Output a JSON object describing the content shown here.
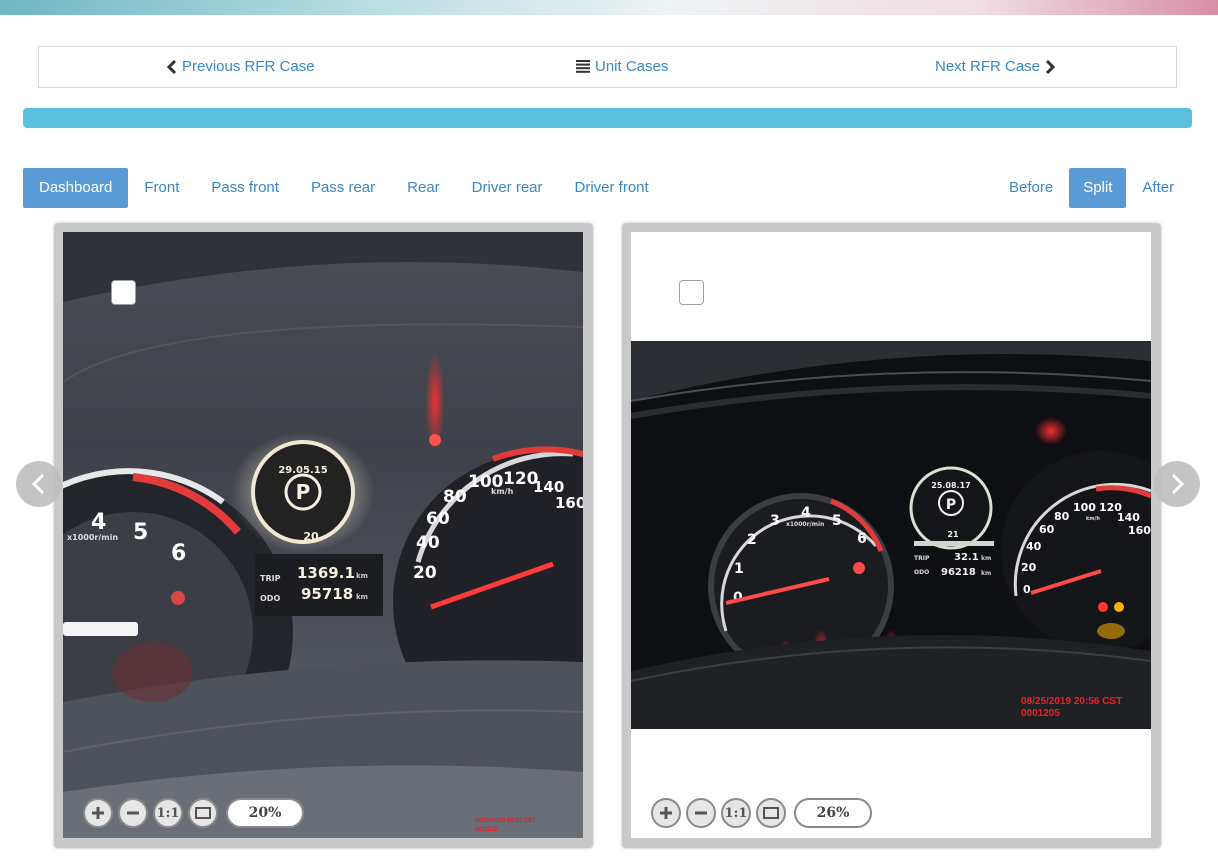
{
  "nav": {
    "previous": "Previous RFR Case",
    "unit_cases": "Unit Cases",
    "next": "Next RFR Case"
  },
  "colors": {
    "link": "#3b86c4",
    "active_tab": "#5b9bd5",
    "progress": "#5bc0de",
    "stamp": "#e8202a"
  },
  "progress": {
    "fraction": 1.0
  },
  "tabs": [
    {
      "label": "Dashboard",
      "active": true
    },
    {
      "label": "Front",
      "active": false
    },
    {
      "label": "Pass front",
      "active": false
    },
    {
      "label": "Pass rear",
      "active": false
    },
    {
      "label": "Rear",
      "active": false
    },
    {
      "label": "Driver rear",
      "active": false
    },
    {
      "label": "Driver front",
      "active": false
    }
  ],
  "view_modes": [
    {
      "label": "Before",
      "active": false
    },
    {
      "label": "Split",
      "active": true
    },
    {
      "label": "After",
      "active": false
    }
  ],
  "panels": {
    "before": {
      "zoom": "20%",
      "zoom_one_to_one": "1:1",
      "cluster": {
        "date": "29.05.15",
        "gear": "P",
        "trip_label": "TRIP",
        "trip_value": "1369.1",
        "trip_unit": "km",
        "odo_label": "ODO",
        "odo_value": "95718",
        "odo_unit": "km",
        "temp": "20",
        "tach_unit": "x1000r/min",
        "speed_unit": "km/h",
        "tach_ticks": [
          "4",
          "5",
          "6"
        ],
        "speed_ticks": [
          "20",
          "40",
          "60",
          "80",
          "100",
          "120",
          "140",
          "160"
        ]
      },
      "stamp_line1": "08/23/2019 16:23 CST",
      "stamp_line2": "681GLD"
    },
    "after": {
      "zoom": "26%",
      "zoom_one_to_one": "1:1",
      "cluster": {
        "date": "25.08.17",
        "gear": "P",
        "trip_label": "TRIP",
        "trip_value": "32.1",
        "trip_unit": "km",
        "odo_label": "ODO",
        "odo_value": "96218",
        "odo_unit": "km",
        "temp": "21",
        "tach_unit": "x1000r/min",
        "speed_unit": "km/h",
        "tach_ticks": [
          "0",
          "1",
          "2",
          "3",
          "4",
          "5",
          "6"
        ],
        "speed_ticks": [
          "0",
          "20",
          "40",
          "60",
          "80",
          "100",
          "120",
          "140",
          "160"
        ]
      },
      "stamp_line1": "08/25/2019 20:56 CST",
      "stamp_line2": "0001205"
    }
  }
}
